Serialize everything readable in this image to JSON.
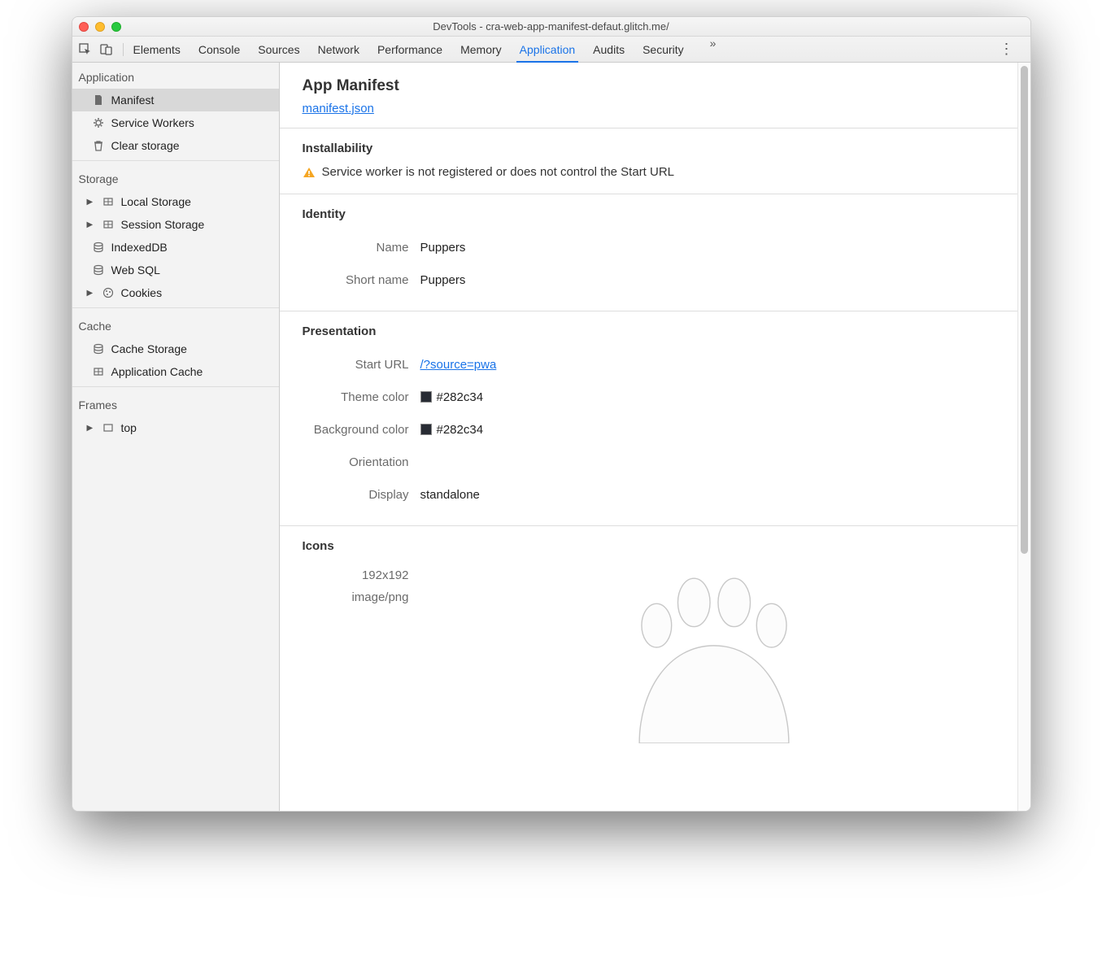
{
  "window": {
    "title": "DevTools - cra-web-app-manifest-defaut.glitch.me/"
  },
  "toolbar": {
    "tabs": [
      "Elements",
      "Console",
      "Sources",
      "Network",
      "Performance",
      "Memory",
      "Application",
      "Audits",
      "Security"
    ],
    "active": "Application",
    "more_glyph": "»",
    "kebab_glyph": "⋮"
  },
  "sidebar": {
    "sections": [
      {
        "title": "Application",
        "items": [
          {
            "label": "Manifest",
            "icon": "file",
            "selected": true,
            "expandable": false
          },
          {
            "label": "Service Workers",
            "icon": "gear",
            "selected": false,
            "expandable": false
          },
          {
            "label": "Clear storage",
            "icon": "trash",
            "selected": false,
            "expandable": false
          }
        ]
      },
      {
        "title": "Storage",
        "items": [
          {
            "label": "Local Storage",
            "icon": "grid",
            "expandable": true
          },
          {
            "label": "Session Storage",
            "icon": "grid",
            "expandable": true
          },
          {
            "label": "IndexedDB",
            "icon": "db",
            "expandable": false
          },
          {
            "label": "Web SQL",
            "icon": "db",
            "expandable": false
          },
          {
            "label": "Cookies",
            "icon": "cookie",
            "expandable": true
          }
        ]
      },
      {
        "title": "Cache",
        "items": [
          {
            "label": "Cache Storage",
            "icon": "db",
            "expandable": false
          },
          {
            "label": "Application Cache",
            "icon": "grid",
            "expandable": false
          }
        ]
      },
      {
        "title": "Frames",
        "items": [
          {
            "label": "top",
            "icon": "frame",
            "expandable": true
          }
        ]
      }
    ]
  },
  "main": {
    "heading": "App Manifest",
    "manifest_link": "manifest.json",
    "installability": {
      "title": "Installability",
      "warning": "Service worker is not registered or does not control the Start URL"
    },
    "identity": {
      "title": "Identity",
      "name_label": "Name",
      "name_value": "Puppers",
      "short_name_label": "Short name",
      "short_name_value": "Puppers"
    },
    "presentation": {
      "title": "Presentation",
      "start_url_label": "Start URL",
      "start_url_value": "/?source=pwa",
      "theme_label": "Theme color",
      "theme_value": "#282c34",
      "bg_label": "Background color",
      "bg_value": "#282c34",
      "orientation_label": "Orientation",
      "orientation_value": "",
      "display_label": "Display",
      "display_value": "standalone"
    },
    "icons": {
      "title": "Icons",
      "size": "192x192",
      "mime": "image/png"
    }
  }
}
